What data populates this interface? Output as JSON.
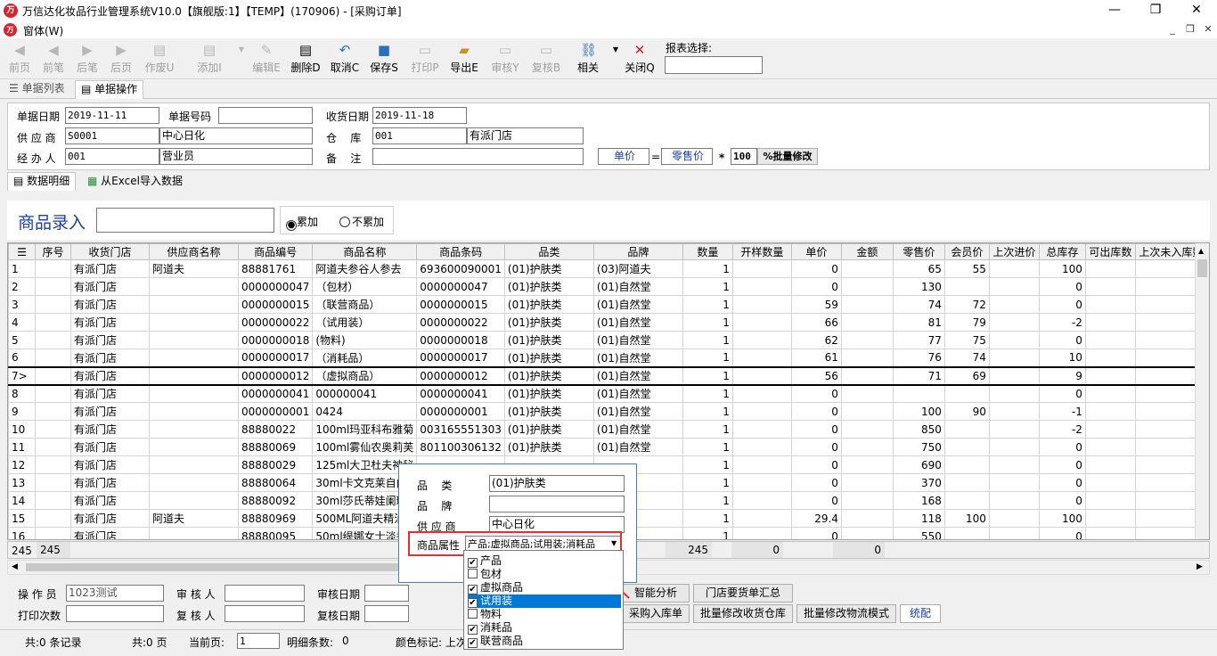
{
  "window": {
    "title": "万信达化妆品行业管理系统V10.0【旗舰版:1】【TEMP】(170906) - [采购订单]",
    "logo": "万",
    "menu_label": "窗体(W)"
  },
  "toolbar": {
    "buttons": [
      {
        "label": "前页",
        "icon": "◀"
      },
      {
        "label": "前笔",
        "icon": "◀"
      },
      {
        "label": "后笔",
        "icon": "▶"
      },
      {
        "label": "后页",
        "icon": "▶"
      },
      {
        "label": "作废U",
        "icon": "▤"
      },
      {
        "label": "添加I",
        "icon": "▤"
      },
      {
        "label": "编辑E",
        "icon": "✎"
      },
      {
        "label": "删除D",
        "icon": "▤"
      },
      {
        "label": "取消C",
        "icon": "↶"
      },
      {
        "label": "保存S",
        "icon": "■"
      },
      {
        "label": "打印P",
        "icon": "▭"
      },
      {
        "label": "导出E",
        "icon": "▰"
      },
      {
        "label": "审核Y",
        "icon": "▭"
      },
      {
        "label": "复核B",
        "icon": "▭"
      },
      {
        "label": "相关",
        "icon": "⛓"
      },
      {
        "label": "关闭Q",
        "icon": "✕"
      }
    ],
    "report_label": "报表选择:",
    "report_value": ""
  },
  "tabs": {
    "list": "单据列表",
    "edit": "单据操作",
    "detail": "数据明细",
    "excel": "从Excel导入数据"
  },
  "form": {
    "doc_date_label": "单据日期",
    "doc_date": "2019-11-11",
    "doc_no_label": "单据号码",
    "doc_no": "",
    "recv_date_label": "收货日期",
    "recv_date": "2019-11-18",
    "supplier_label": "供 应 商",
    "supplier_code": "S0001",
    "supplier_name": "中心日化",
    "warehouse_label": "仓    库",
    "warehouse_code": "001",
    "warehouse_name": "有派门店",
    "handler_label": "经 办 人",
    "handler_code": "001",
    "handler_name": "营业员",
    "remark_label": "备    注",
    "remark": "",
    "price_label": "单价",
    "eq": "=",
    "retail_label": "零售价",
    "mul": "*",
    "factor": "100",
    "batch_btn": "%批量修改"
  },
  "entry": {
    "label": "商品录入",
    "value": "",
    "opt_acc": "累加",
    "opt_noacc": "不累加"
  },
  "grid": {
    "columns": [
      "序号",
      "收货门店",
      "供应商名称",
      "商品编号",
      "商品名称",
      "商品条码",
      "品类",
      "品牌",
      "数量",
      "开样数量",
      "单价",
      "金额",
      "零售价",
      "会员价",
      "上次进价",
      "总库存",
      "可出库数",
      "上次未入库数"
    ],
    "rows": [
      [
        "1",
        "有派门店",
        "阿道夫",
        "88881761",
        "阿道夫参谷人参去",
        "693600090001",
        "(01)护肤类",
        "(03)阿道夫",
        "1",
        "",
        "0",
        "",
        "65",
        "55",
        "",
        "100",
        "",
        ""
      ],
      [
        "2",
        "有派门店",
        "",
        "0000000047",
        "（包材）",
        "0000000047",
        "(01)护肤类",
        "(01)自然堂",
        "1",
        "",
        "0",
        "",
        "130",
        "",
        "",
        "0",
        "",
        ""
      ],
      [
        "3",
        "有派门店",
        "",
        "0000000015",
        "（联营商品）",
        "0000000015",
        "(01)护肤类",
        "(01)自然堂",
        "1",
        "",
        "59",
        "",
        "74",
        "72",
        "",
        "0",
        "",
        ""
      ],
      [
        "4",
        "有派门店",
        "",
        "0000000022",
        "（试用装）",
        "0000000022",
        "(01)护肤类",
        "(01)自然堂",
        "1",
        "",
        "66",
        "",
        "81",
        "79",
        "",
        "-2",
        "",
        ""
      ],
      [
        "5",
        "有派门店",
        "",
        "0000000018",
        "(物料)",
        "0000000018",
        "(01)护肤类",
        "(01)自然堂",
        "1",
        "",
        "62",
        "",
        "77",
        "75",
        "",
        "0",
        "",
        ""
      ],
      [
        "6",
        "有派门店",
        "",
        "0000000017",
        "（消耗品）",
        "0000000017",
        "(01)护肤类",
        "(01)自然堂",
        "1",
        "",
        "61",
        "",
        "76",
        "74",
        "",
        "10",
        "",
        ""
      ],
      [
        "7>",
        "有派门店",
        "",
        "0000000012",
        "（虚拟商品）",
        "0000000012",
        "(01)护肤类",
        "(01)自然堂",
        "1",
        "",
        "56",
        "",
        "71",
        "69",
        "",
        "9",
        "",
        ""
      ],
      [
        "8",
        "有派门店",
        "",
        "0000000041",
        "000000041",
        "0000000041",
        "(01)护肤类",
        "(01)自然堂",
        "1",
        "",
        "0",
        "",
        "",
        "",
        "",
        "0",
        "",
        ""
      ],
      [
        "9",
        "有派门店",
        "",
        "0000000001",
        "0424",
        "0000000001",
        "(01)护肤类",
        "(01)自然堂",
        "1",
        "",
        "0",
        "",
        "100",
        "90",
        "",
        "-1",
        "",
        ""
      ],
      [
        "10",
        "有派门店",
        "",
        "88880022",
        "100ml玛亚科布雅菊",
        "003165551303",
        "(01)护肤类",
        "(01)自然堂",
        "1",
        "",
        "0",
        "",
        "850",
        "",
        "",
        "-2",
        "",
        ""
      ],
      [
        "11",
        "有派门店",
        "",
        "88880069",
        "100ml雾仙农奥莉芙",
        "801100306132",
        "(01)护肤类",
        "(01)自然堂",
        "1",
        "",
        "0",
        "",
        "750",
        "",
        "",
        "0",
        "",
        ""
      ],
      [
        "12",
        "有派门店",
        "",
        "88880029",
        "125ml大卫杜夫神秘",
        "",
        "",
        "",
        "1",
        "",
        "0",
        "",
        "690",
        "",
        "",
        "0",
        "",
        ""
      ],
      [
        "13",
        "有派门店",
        "",
        "88880064",
        "30ml卡文克莱自由",
        "",
        "",
        "",
        "1",
        "",
        "0",
        "",
        "370",
        "",
        "",
        "0",
        "",
        ""
      ],
      [
        "14",
        "有派门店",
        "",
        "88880092",
        "30ml莎氏蒂娃阑珊",
        "",
        "",
        "",
        "1",
        "",
        "0",
        "",
        "168",
        "",
        "",
        "0",
        "",
        ""
      ],
      [
        "15",
        "有派门店",
        "阿道夫",
        "88880969",
        "500ML阿道夫精油",
        "",
        "",
        "",
        "1",
        "",
        "29.4",
        "",
        "118",
        "100",
        "",
        "100",
        "",
        ""
      ],
      [
        "16",
        "有派门店",
        "",
        "88880095",
        "50ml缇娜女士淡香",
        "",
        "",
        "",
        "1",
        "",
        "0",
        "",
        "550",
        "",
        "",
        "0",
        "",
        ""
      ]
    ],
    "footer": {
      "count_left": "245",
      "count": "245",
      "qty": "245",
      "amount": "0",
      "retail": "0"
    }
  },
  "popup": {
    "category_label": "品    类",
    "category": "(01)护肤类",
    "brand_label": "品    牌",
    "brand": "",
    "supplier_label": "供 应 商",
    "supplier": "中心日化",
    "attr_label": "商品属性",
    "attr": "产品;虚拟商品;试用装;消耗品",
    "options": [
      {
        "label": "产品",
        "checked": "✔"
      },
      {
        "label": "包材",
        "checked": ""
      },
      {
        "label": "虚拟商品",
        "checked": "✔"
      },
      {
        "label": "试用装",
        "checked": "✔"
      },
      {
        "label": "物料",
        "checked": ""
      },
      {
        "label": "消耗品",
        "checked": "✔"
      },
      {
        "label": "联营商品",
        "checked": "✔"
      }
    ]
  },
  "bottom": {
    "operator_label": "操 作 员",
    "operator": "1023测试",
    "auditor_label": "审 核 人",
    "auditor": "",
    "audit_date_label": "审核日期",
    "audit_date": "",
    "print_count_label": "打印次数",
    "print_count": "",
    "reviewer_label": "复 核 人",
    "reviewer": "",
    "review_date_label": "复核日期",
    "review_date": "",
    "btn_smart": "智能分析",
    "btn_store_summary": "门店要货单汇总",
    "btn_purchase_in": "采购入库单",
    "btn_batch_warehouse": "批量修改收货仓库",
    "btn_batch_logistics": "批量修改物流模式",
    "btn_allocate": "统配"
  },
  "status": {
    "records": "共:0 条记录",
    "pages": "共:0 页",
    "cur_page_label": "当前页:",
    "cur_page": "1",
    "detail_label": "明细条数:",
    "detail_count": "0",
    "color_label": "颜色标记: 上次"
  }
}
